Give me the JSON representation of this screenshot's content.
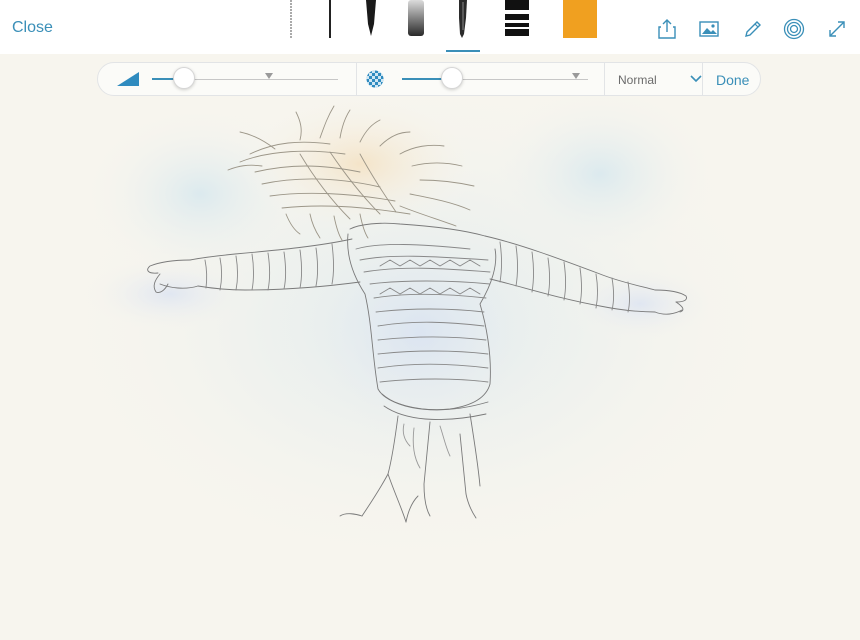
{
  "header": {
    "close_label": "Close",
    "brushes": [
      {
        "name": "thin-pencil-brush"
      },
      {
        "name": "fine-pen-brush"
      },
      {
        "name": "ink-brush"
      },
      {
        "name": "marker-brush"
      },
      {
        "name": "felt-tip-brush"
      },
      {
        "name": "stripe-brush"
      }
    ],
    "active_brush": "felt-tip-brush",
    "color": "#f0a020",
    "icons": [
      "share-icon",
      "image-icon",
      "pencil-icon",
      "layers-icon",
      "expand-icon"
    ]
  },
  "brush_toolbar": {
    "size_slider": {
      "icon": "brush-size-icon",
      "value": 0.13
    },
    "opacity_slider": {
      "icon": "opacity-icon",
      "value": 0.24
    },
    "blend_mode": "Normal",
    "done_label": "Done"
  },
  "colors": {
    "accent": "#3a8fb8",
    "selected_color": "#f0a020"
  }
}
